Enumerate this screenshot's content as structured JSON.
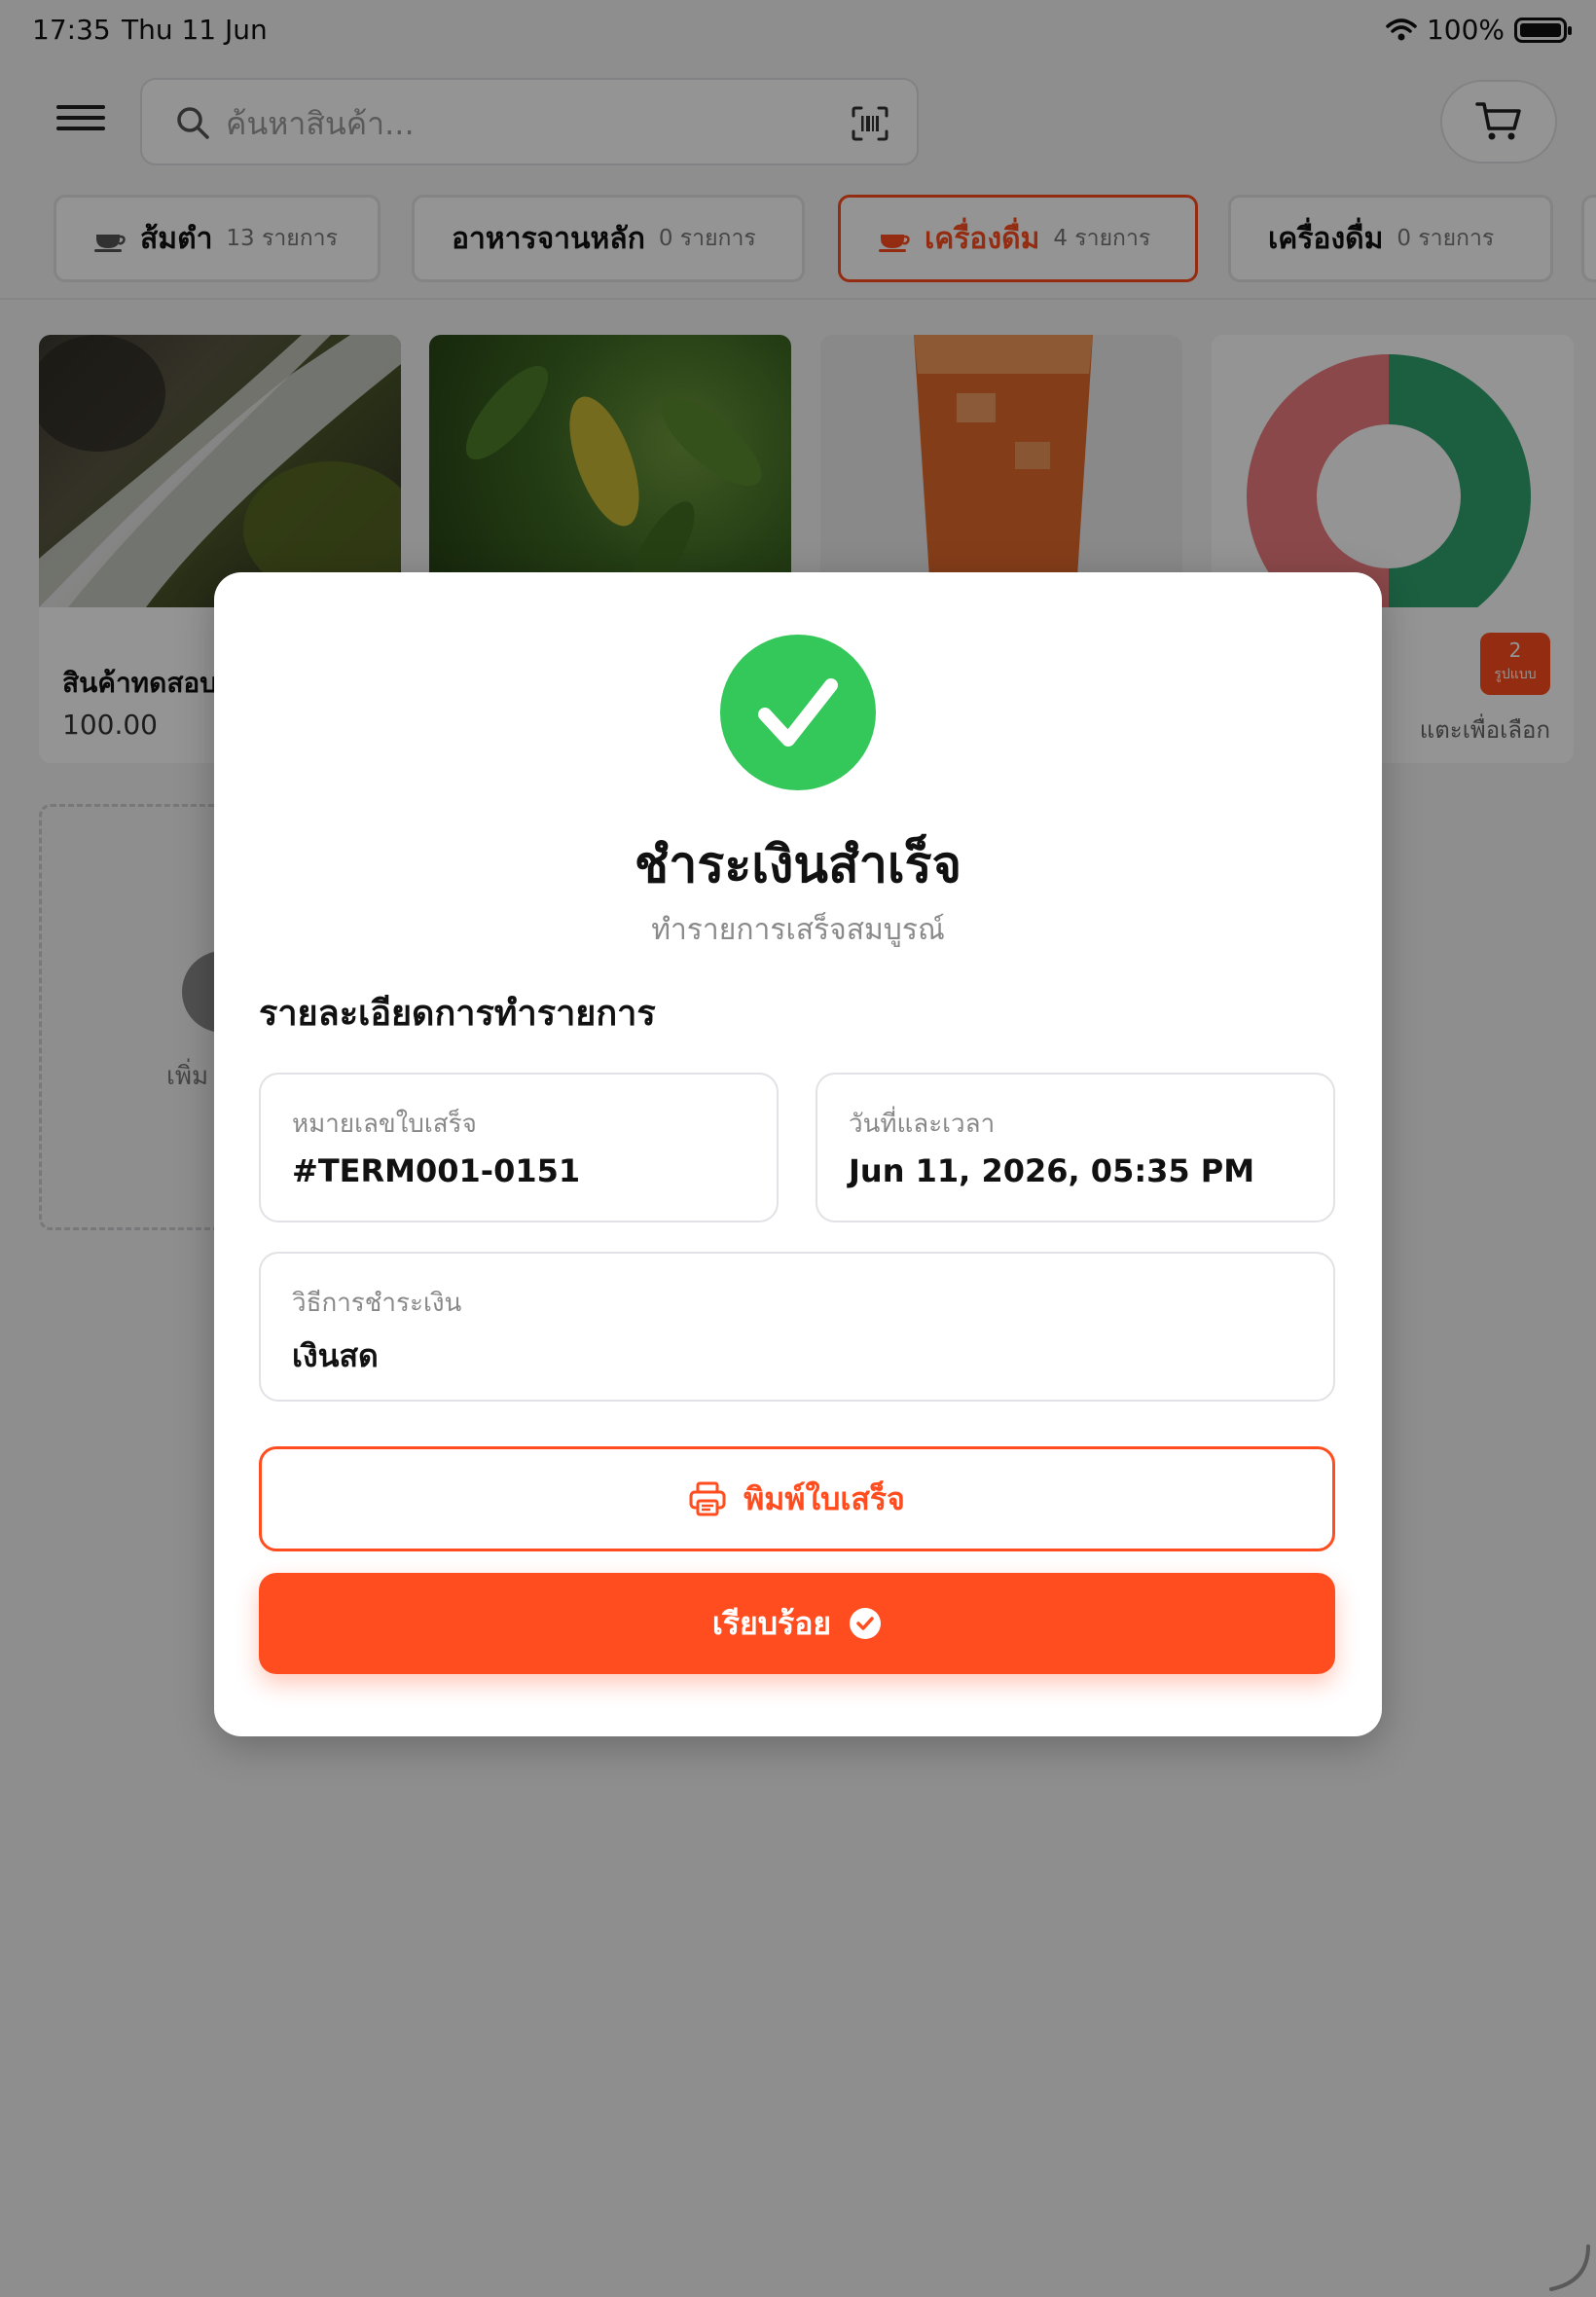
{
  "status_bar": {
    "time": "17:35",
    "date": "Thu 11 Jun",
    "battery": "100%"
  },
  "search": {
    "placeholder": "ค้นหาสินค้า...",
    "value": ""
  },
  "categories": [
    {
      "name": "ส้มตำ",
      "count": "13 รายการ",
      "active": false,
      "icon": "cup-icon"
    },
    {
      "name": "อาหารจานหลัก",
      "count": "0 รายการ",
      "active": false
    },
    {
      "name": "เครื่องดื่ม",
      "count": "4 รายการ",
      "active": true,
      "icon": "cup-icon"
    },
    {
      "name": "เครื่องดื่ม",
      "count": "0 รายการ",
      "active": false
    }
  ],
  "products": [
    {
      "name": "สินค้าทดสอบ",
      "price": "100.00"
    },
    {
      "name": "",
      "price": ""
    },
    {
      "name": "",
      "price": ""
    },
    {
      "badge_number": "2",
      "badge_unit": "รูปแบบ",
      "tap_label": "แตะเพื่อเลือก"
    }
  ],
  "add_card_label": "เพิ่ม",
  "modal": {
    "title": "ชำระเงินสำเร็จ",
    "subtitle": "ทำรายการเสร็จสมบูรณ์",
    "details_heading": "รายละเอียดการทำรายการ",
    "receipt": {
      "label": "หมายเลขใบเสร็จ",
      "value": "#TERM001-0151"
    },
    "datetime": {
      "label": "วันที่และเวลา",
      "value": "Jun 11, 2026, 05:35 PM"
    },
    "payment_method": {
      "label": "วิธีการชำระเงิน",
      "value": "เงินสด"
    },
    "print_button": "พิมพ์ใบเสร็จ",
    "done_button": "เรียบร้อย"
  },
  "colors": {
    "accent": "#ff4d1f",
    "success": "#34c759",
    "overlay": "rgba(0,0,0,0.42)"
  }
}
